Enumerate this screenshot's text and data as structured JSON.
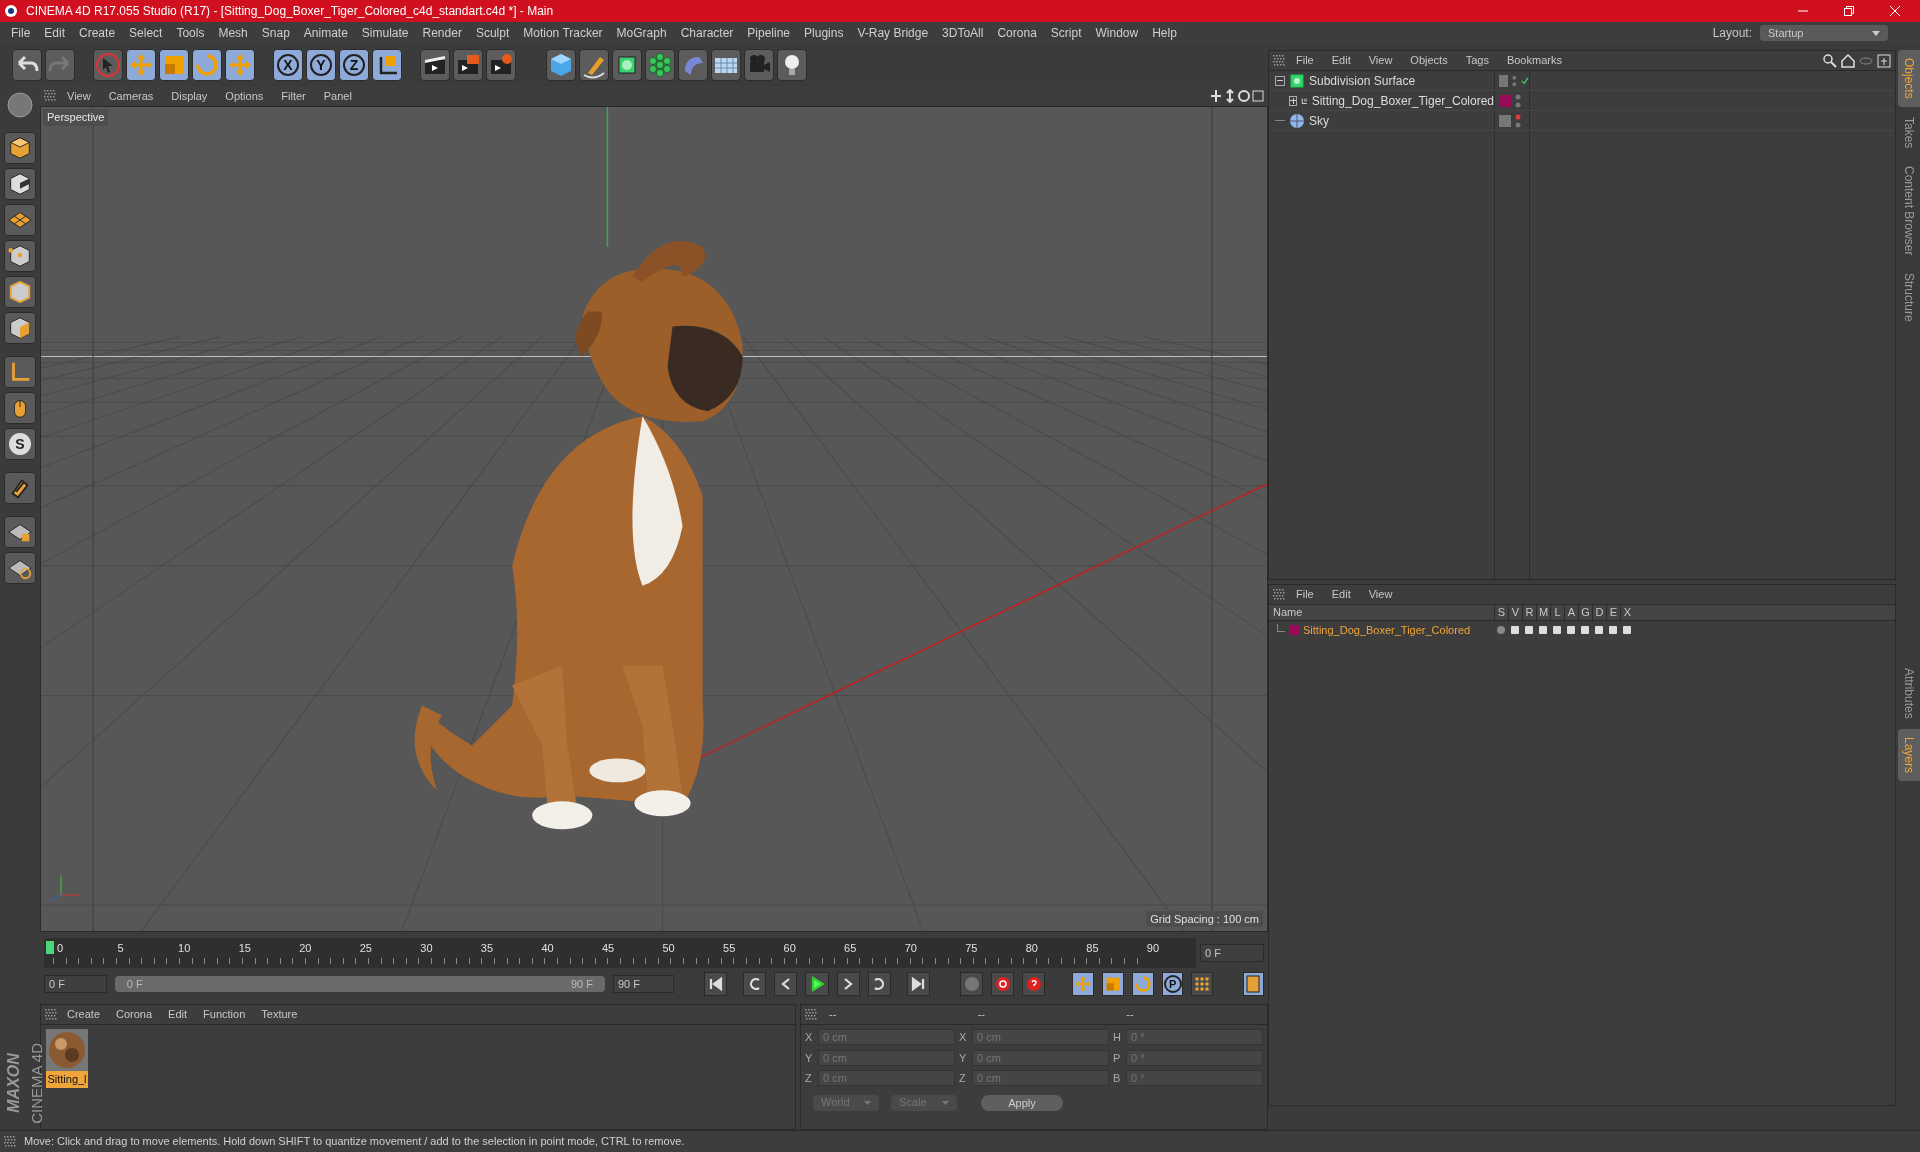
{
  "window": {
    "title": "CINEMA 4D R17.055 Studio (R17) - [Sitting_Dog_Boxer_Tiger_Colored_c4d_standart.c4d *] - Main"
  },
  "menu": [
    "File",
    "Edit",
    "Create",
    "Select",
    "Tools",
    "Mesh",
    "Snap",
    "Animate",
    "Simulate",
    "Render",
    "Sculpt",
    "Motion Tracker",
    "MoGraph",
    "Character",
    "Pipeline",
    "Plugins",
    "V-Ray Bridge",
    "3DToAll",
    "Corona",
    "Script",
    "Window",
    "Help"
  ],
  "layout": {
    "label": "Layout:",
    "value": "Startup"
  },
  "axis_buttons": [
    "X",
    "Y",
    "Z"
  ],
  "snap_letter": "S",
  "viewport": {
    "menu": [
      "View",
      "Cameras",
      "Display",
      "Options",
      "Filter",
      "Panel"
    ],
    "camera": "Perspective",
    "grid_spacing": "Grid Spacing : 100 cm"
  },
  "timeline": {
    "ticks": [
      "0",
      "5",
      "10",
      "15",
      "20",
      "25",
      "30",
      "35",
      "40",
      "45",
      "50",
      "55",
      "60",
      "65",
      "70",
      "75",
      "80",
      "85",
      "90"
    ],
    "current": "0 F",
    "start": "0 F",
    "range": {
      "start": "0 F",
      "end": "90 F",
      "level": 1
    },
    "end": "90 F",
    "param_letter": "P"
  },
  "materials": {
    "menu": [
      "Create",
      "Corona",
      "Edit",
      "Function",
      "Texture"
    ],
    "items": [
      {
        "name": "Sitting_l",
        "selected": true
      }
    ]
  },
  "brand": {
    "company": "MAXON",
    "product": "CINEMA 4D"
  },
  "coordinates": {
    "headers": [
      "--",
      "--",
      "--"
    ],
    "rows": [
      {
        "axis": "X",
        "position": "0 cm",
        "size_axis": "X",
        "size": "0 cm",
        "rot_axis": "H",
        "rotation": "0 °"
      },
      {
        "axis": "Y",
        "position": "0 cm",
        "size_axis": "Y",
        "size": "0 cm",
        "rot_axis": "P",
        "rotation": "0 °"
      },
      {
        "axis": "Z",
        "position": "0 cm",
        "size_axis": "Z",
        "size": "0 cm",
        "rot_axis": "B",
        "rotation": "0 °"
      }
    ],
    "dropdowns": [
      "World",
      "Scale"
    ],
    "apply": "Apply"
  },
  "objects": {
    "menu": [
      "File",
      "Edit",
      "View",
      "Objects",
      "Tags",
      "Bookmarks"
    ],
    "items": [
      {
        "name": "Subdivision Surface",
        "kind": "subdivision",
        "expanded": true,
        "checked": true,
        "render_off": false,
        "children": [
          {
            "name": "Sitting_Dog_Boxer_Tiger_Colored",
            "kind": "null",
            "expanded": false,
            "checked": false,
            "render_off": false,
            "color": "#9a0a5a"
          }
        ]
      },
      {
        "name": "Sky",
        "kind": "sky",
        "checked": false,
        "render_off": true
      }
    ]
  },
  "layers": {
    "menu": [
      "File",
      "Edit",
      "View"
    ],
    "columns": [
      "Name",
      "S",
      "V",
      "R",
      "M",
      "L",
      "A",
      "G",
      "D",
      "E",
      "X"
    ],
    "rows": [
      {
        "name": "Sitting_Dog_Boxer_Tiger_Colored",
        "color": "#9a0a5a"
      }
    ]
  },
  "side_tabs": [
    {
      "label": "Objects",
      "selected": true
    },
    {
      "label": "Takes",
      "selected": false
    },
    {
      "label": "Content Browser",
      "selected": false
    },
    {
      "label": "Structure",
      "selected": false
    }
  ],
  "side_tabs_lower": [
    {
      "label": "Attributes",
      "selected": false
    },
    {
      "label": "Layers",
      "selected": true
    }
  ],
  "status_bar": "Move: Click and drag to move elements. Hold down SHIFT to quantize movement / add to the selection in point mode, CTRL to remove."
}
